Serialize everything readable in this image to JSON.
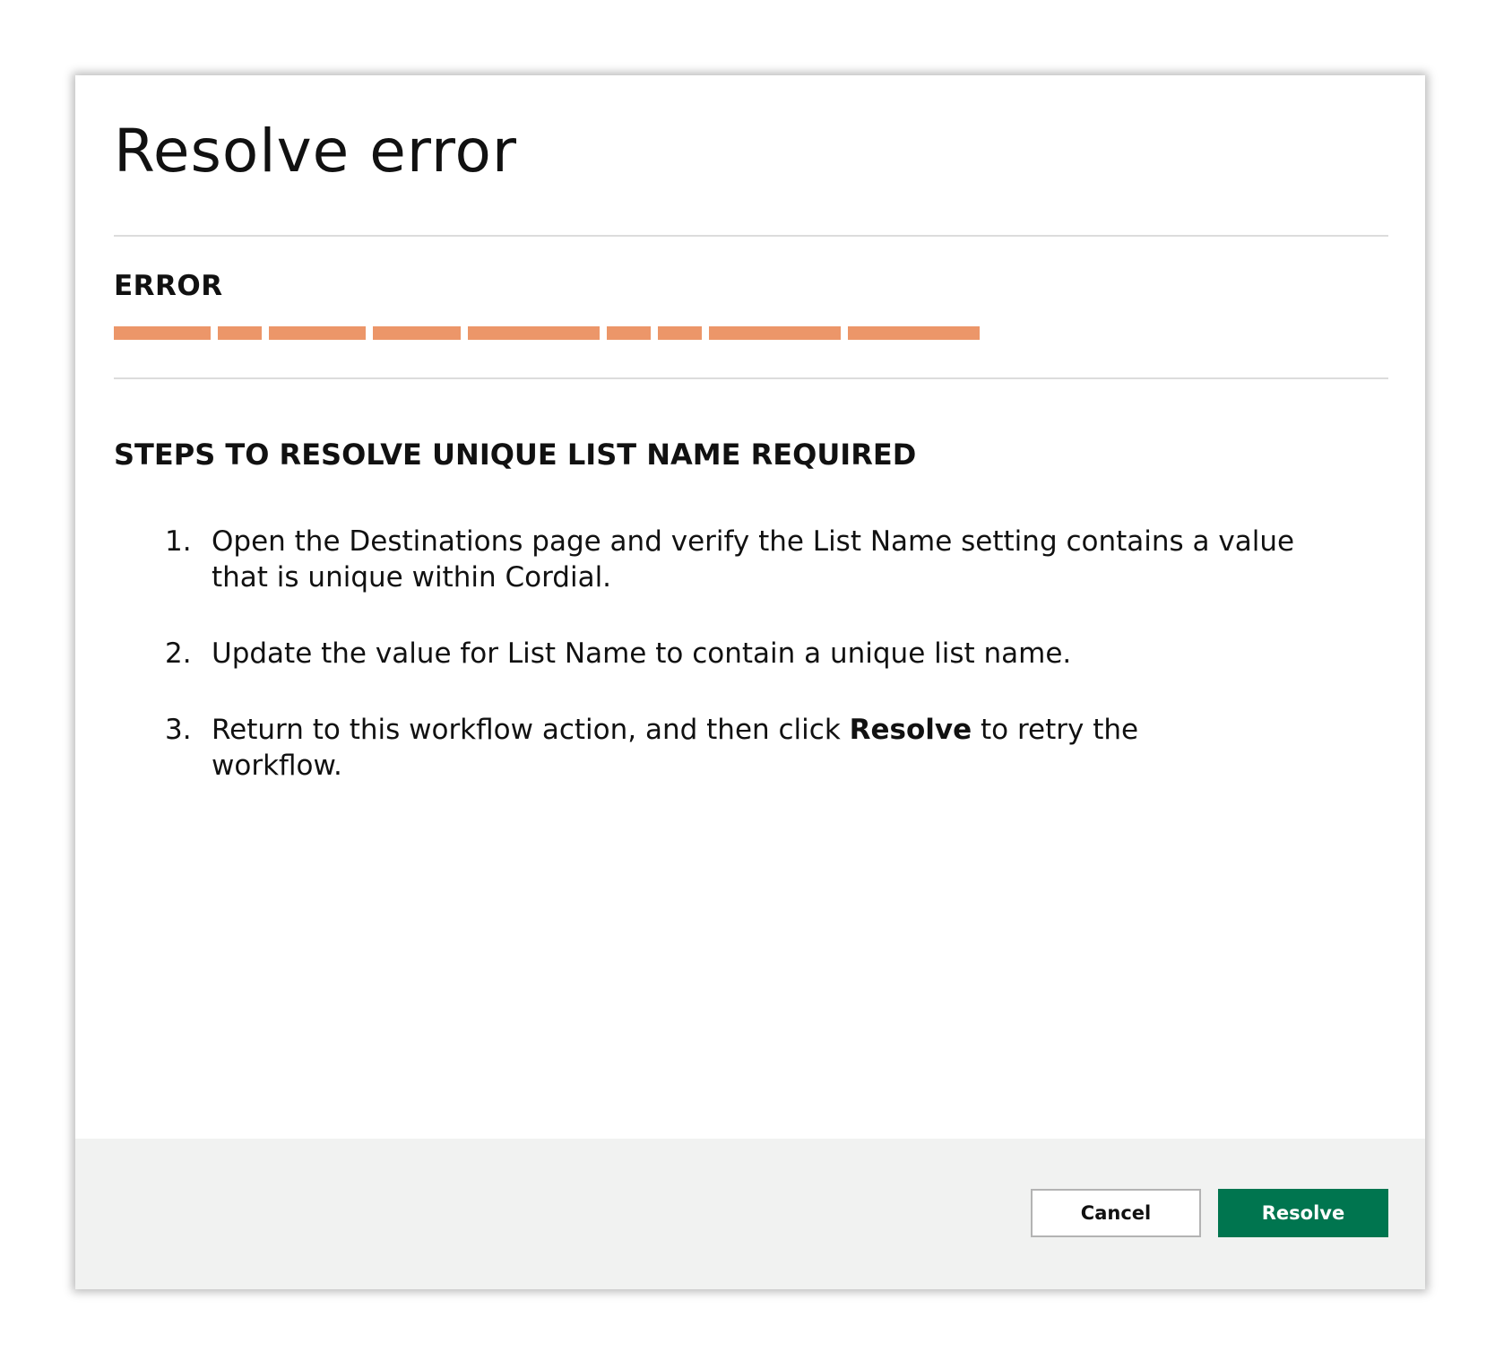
{
  "dialog": {
    "title": "Resolve error"
  },
  "error": {
    "label": "ERROR"
  },
  "steps": {
    "heading": "STEPS TO RESOLVE UNIQUE LIST NAME REQUIRED",
    "items": [
      {
        "number": "1.",
        "text": "Open the Destinations page and verify the List Name setting contains a value that is unique within Cordial."
      },
      {
        "number": "2.",
        "text": "Update the value for List Name to contain a unique list name."
      },
      {
        "number": "3.",
        "text_before": "Return to this workflow action, and then click ",
        "text_bold": "Resolve",
        "text_after": " to retry the workflow."
      }
    ]
  },
  "footer": {
    "cancel_label": "Cancel",
    "resolve_label": "Resolve"
  },
  "colors": {
    "redaction": "#ec9669",
    "primary_button": "#00754f",
    "footer_background": "#f1f2f1"
  }
}
